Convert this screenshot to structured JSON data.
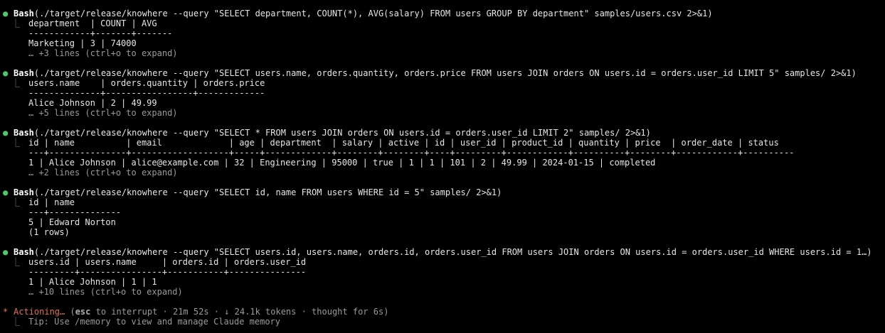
{
  "colors": {
    "background": "#000000",
    "text": "#e6e6e6",
    "bullet_success": "#4ec86b",
    "status_accent": "#e0734f",
    "muted": "#9a9a9a"
  },
  "tool_calls": [
    {
      "tool": "Bash",
      "command": "(./target/release/knowhere --query \"SELECT department, COUNT(*), AVG(salary) FROM users GROUP BY department\" samples/users.csv 2>&1)",
      "output_header": "department  | COUNT | AVG",
      "output_separator": "------------+-------+-------",
      "output_rows": [
        "Marketing | 3 | 74000"
      ],
      "collapsed_note": "… +3 lines (ctrl+o to expand)"
    },
    {
      "tool": "Bash",
      "command": "(./target/release/knowhere --query \"SELECT users.name, orders.quantity, orders.price FROM users JOIN orders ON users.id = orders.user_id LIMIT 5\" samples/ 2>&1)",
      "output_header": "users.name    | orders.quantity | orders.price",
      "output_separator": "--------------+-----------------+-------------",
      "output_rows": [
        "Alice Johnson | 2 | 49.99"
      ],
      "collapsed_note": "… +5 lines (ctrl+o to expand)"
    },
    {
      "tool": "Bash",
      "command": "(./target/release/knowhere --query \"SELECT * FROM users JOIN orders ON users.id = orders.user_id LIMIT 2\" samples/ 2>&1)",
      "output_header": "id | name          | email             | age | department  | salary | active | id | user_id | product_id | quantity | price  | order_date | status",
      "output_separator": "---+---------------+-------------------+-----+-------------+--------+--------+----+---------+------------+----------+--------+------------+----------",
      "output_rows": [
        "1 | Alice Johnson | alice@example.com | 32 | Engineering | 95000 | true | 1 | 1 | 101 | 2 | 49.99 | 2024-01-15 | completed"
      ],
      "collapsed_note": "… +2 lines (ctrl+o to expand)"
    },
    {
      "tool": "Bash",
      "command": "(./target/release/knowhere --query \"SELECT id, name FROM users WHERE id = 5\" samples/ 2>&1)",
      "output_header": "id | name",
      "output_separator": "---+--------------",
      "output_rows": [
        "5 | Edward Norton",
        "(1 rows)"
      ],
      "collapsed_note": ""
    },
    {
      "tool": "Bash",
      "command": "(./target/release/knowhere --query \"SELECT users.id, users.name, orders.id, orders.user_id FROM users JOIN orders ON users.id = orders.user_id WHERE users.id = 1…)",
      "output_header": "users.id | users.name     | orders.id | orders.user_id",
      "output_separator": "---------+----------------+-----------+---------------",
      "output_rows": [
        "1 | Alice Johnson | 1 | 1"
      ],
      "collapsed_note": "… +10 lines (ctrl+o to expand)"
    }
  ],
  "status": {
    "star": "*",
    "word": "Actioning…",
    "open_paren": " (",
    "key": "esc",
    "rest": " to interrupt · 21m 52s · ↓ 24.1k tokens · thought for 6s)"
  },
  "tip": {
    "elbow": "⎿",
    "text": "Tip: Use /memory to view and manage Claude memory"
  },
  "glyphs": {
    "bullet": "●",
    "elbow": "⎿"
  }
}
